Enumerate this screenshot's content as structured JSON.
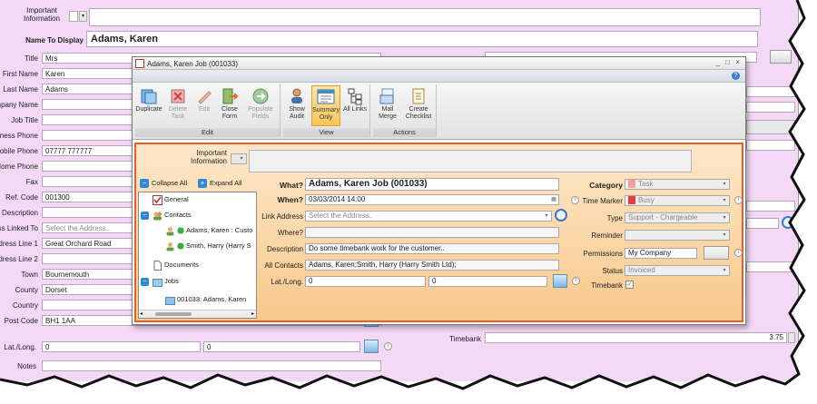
{
  "background_form": {
    "important_information_label": "Important Information",
    "name_to_display_label": "Name To Display",
    "name_to_display_value": "Adams, Karen",
    "fields": [
      {
        "label": "Title",
        "value": "Mrs",
        "placeholder": false
      },
      {
        "label": "First Name",
        "value": "Karen",
        "placeholder": false
      },
      {
        "label": "Last Name",
        "value": "Adams",
        "placeholder": false
      },
      {
        "label": "ompany Name",
        "value": "",
        "placeholder": false
      },
      {
        "label": "Job Title",
        "value": "",
        "placeholder": false
      },
      {
        "label": "siness Phone",
        "value": "",
        "placeholder": false
      },
      {
        "label": "obile Phone",
        "value": "07777 777777",
        "placeholder": false
      },
      {
        "label": "Home Phone",
        "value": "",
        "placeholder": false
      },
      {
        "label": "Fax",
        "value": "",
        "placeholder": false
      },
      {
        "label": "Ref. Code",
        "value": "001300",
        "placeholder": false
      },
      {
        "label": "Description",
        "value": "",
        "placeholder": false
      },
      {
        "label": "ss Linked To",
        "value": "Select the Address..",
        "placeholder": true
      },
      {
        "label": "ddress Line 1",
        "value": "Great Orchard Road",
        "placeholder": false
      },
      {
        "label": "ddress Line 2",
        "value": "",
        "placeholder": false
      },
      {
        "label": "Town",
        "value": "Bournemouth",
        "placeholder": false
      },
      {
        "label": "County",
        "value": "Dorset",
        "placeholder": false
      },
      {
        "label": "Country",
        "value": "",
        "placeholder": false
      },
      {
        "label": "Post Code",
        "value": "BH1 1AA",
        "placeholder": false
      }
    ],
    "latlong_label": "Lat./Long.",
    "lat_value": "0",
    "long_value": "0",
    "notes_label": "Notes",
    "timebank_label": "Timebank",
    "timebank_value": "3.75"
  },
  "dialog": {
    "title": "Adams, Karen Job (001033)",
    "window_controls": {
      "minimize": "_",
      "maximize": "□",
      "close": "×"
    },
    "help_glyph": "?",
    "ribbon": {
      "groups": [
        {
          "label": "Edit",
          "buttons": [
            {
              "name": "duplicate",
              "label": "Duplicate",
              "disabled": false
            },
            {
              "name": "delete-task",
              "label": "Delete Task",
              "disabled": true
            },
            {
              "name": "edit",
              "label": "Edit",
              "disabled": true
            },
            {
              "name": "close-form",
              "label": "Close Form",
              "disabled": false
            },
            {
              "name": "populate-fields",
              "label": "Populate Fields",
              "disabled": true
            }
          ]
        },
        {
          "label": "View",
          "buttons": [
            {
              "name": "show-audit",
              "label": "Show Audit",
              "disabled": false
            },
            {
              "name": "summary-only",
              "label": "Summary Only",
              "disabled": false,
              "active": true
            },
            {
              "name": "all-links",
              "label": "All Links",
              "disabled": false
            }
          ]
        },
        {
          "label": "Actions",
          "buttons": [
            {
              "name": "mail-merge",
              "label": "Mail Merge",
              "disabled": false
            },
            {
              "name": "create-checklist",
              "label": "Create Checklist",
              "disabled": false
            }
          ]
        }
      ]
    },
    "important_information_label": "Important Information",
    "collapse_all": "Collapse All",
    "expand_all": "Expand All",
    "tree": {
      "general": "General",
      "contacts": "Contacts",
      "contact_1": "Adams, Karen : Custo",
      "contact_2": "Smith, Harry (Harry S",
      "documents": "Documents",
      "jobs": "Jobs",
      "job_1": "001033: Adams, Karen"
    },
    "form": {
      "what_label": "What?",
      "what_value": "Adams, Karen Job (001033)",
      "when_label": "When?",
      "when_value": "03/03/2014 14:00",
      "link_address_label": "Link Address",
      "link_address_placeholder": "Select the Address..",
      "where_label": "Where?",
      "where_value": "",
      "description_label": "Description",
      "description_value": "Do some timebank work for the customer..",
      "all_contacts_label": "All Contacts",
      "all_contacts_value": "Adams, Karen;Smith, Harry (Harry Smith Ltd);",
      "latlong_label": "Lat./Long.",
      "lat_value": "0",
      "long_value": "0",
      "category_label": "Category",
      "category_value": "Task",
      "time_marker_label": "Time Marker",
      "time_marker_value": "Busy",
      "type_label": "Type",
      "type_value": "Support - Chargeable",
      "reminder_label": "Reminder",
      "reminder_value": "",
      "permissions_label": "Permissions",
      "permissions_value": "My Company",
      "status_label": "Status",
      "status_value": "Invoiced",
      "timebank_label": "Timebank",
      "timebank_checked": true
    }
  },
  "colors": {
    "form_bg": "#f4d9f7",
    "dialog_border_accent": "#e85d2a",
    "dialog_body_top": "#fde7c9",
    "dialog_body_bottom": "#f8c98b",
    "accent_blue": "#2f87d6",
    "category_swatch": "#f0a0a0",
    "busy_swatch": "#e04040"
  }
}
